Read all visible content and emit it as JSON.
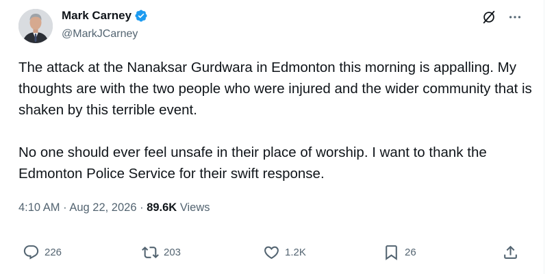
{
  "author": {
    "display_name": "Mark Carney",
    "handle": "@MarkJCarney",
    "verified": true
  },
  "tweet": {
    "paragraphs": [
      "The attack at the Nanaksar Gurdwara in Edmonton this morning is appalling. My thoughts are with the two people who were injured and the wider community that is shaken by this terrible event.",
      "No one should ever feel unsafe in their place of worship. I want to thank the Edmonton Police Service for their swift response."
    ],
    "time": "4:10 AM",
    "separator": "·",
    "date": "Aug 22, 2026",
    "views_count": "89.6K",
    "views_label": "Views"
  },
  "actions": {
    "replies": "226",
    "reposts": "203",
    "likes": "1.2K",
    "bookmarks": "26"
  },
  "icons": {
    "verified": "verified-badge-icon",
    "grok": "grok-icon",
    "more": "more-dots-icon",
    "reply": "reply-icon",
    "repost": "repost-icon",
    "like": "like-icon",
    "bookmark": "bookmark-icon",
    "share": "share-icon"
  },
  "colors": {
    "text_primary": "#0f1419",
    "text_secondary": "#536471",
    "verified_blue": "#1d9bf0"
  }
}
